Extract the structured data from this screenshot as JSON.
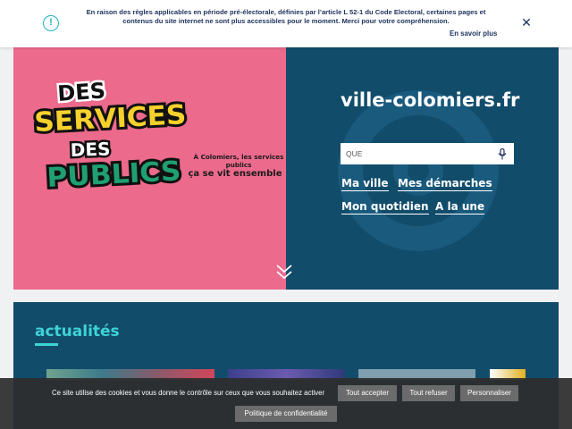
{
  "notice": {
    "text": "En raison des règles applicables en période pré-électorale, définies par l’article L 52-1 du Code Electoral, certaines pages et contenus du site internet ne sont plus accessibles pour le moment. Merci pour votre compréhension.",
    "link": "En savoir plus",
    "close": "✕",
    "icon": "!"
  },
  "hero": {
    "site_title": "ville-colomiers.fr",
    "search_placeholder": "QUE",
    "nav": [
      "Ma ville",
      "Mes démarches",
      "Mon quotidien",
      "A la une"
    ],
    "logo_words": [
      "DES",
      "SERVICES",
      "DES",
      "PUBLICS"
    ],
    "tagline_small": "À Colomiers, les services publics",
    "tagline_big": "ça se vit ensemble !"
  },
  "news": {
    "title": "actualités"
  },
  "cookie": {
    "text": "Ce site utilise des cookies et vous donne le contrôle sur ceux que vous souhaitez activer",
    "accept": "Tout accepter",
    "refuse": "Tout refuser",
    "customize": "Personnaliser",
    "policy": "Politique de confidentialité"
  },
  "colors": {
    "pink": "#ec6a8c",
    "navy": "#124c6b",
    "teal": "#3ed3d6",
    "yellow": "#f6d12c",
    "green": "#1f9f72"
  }
}
